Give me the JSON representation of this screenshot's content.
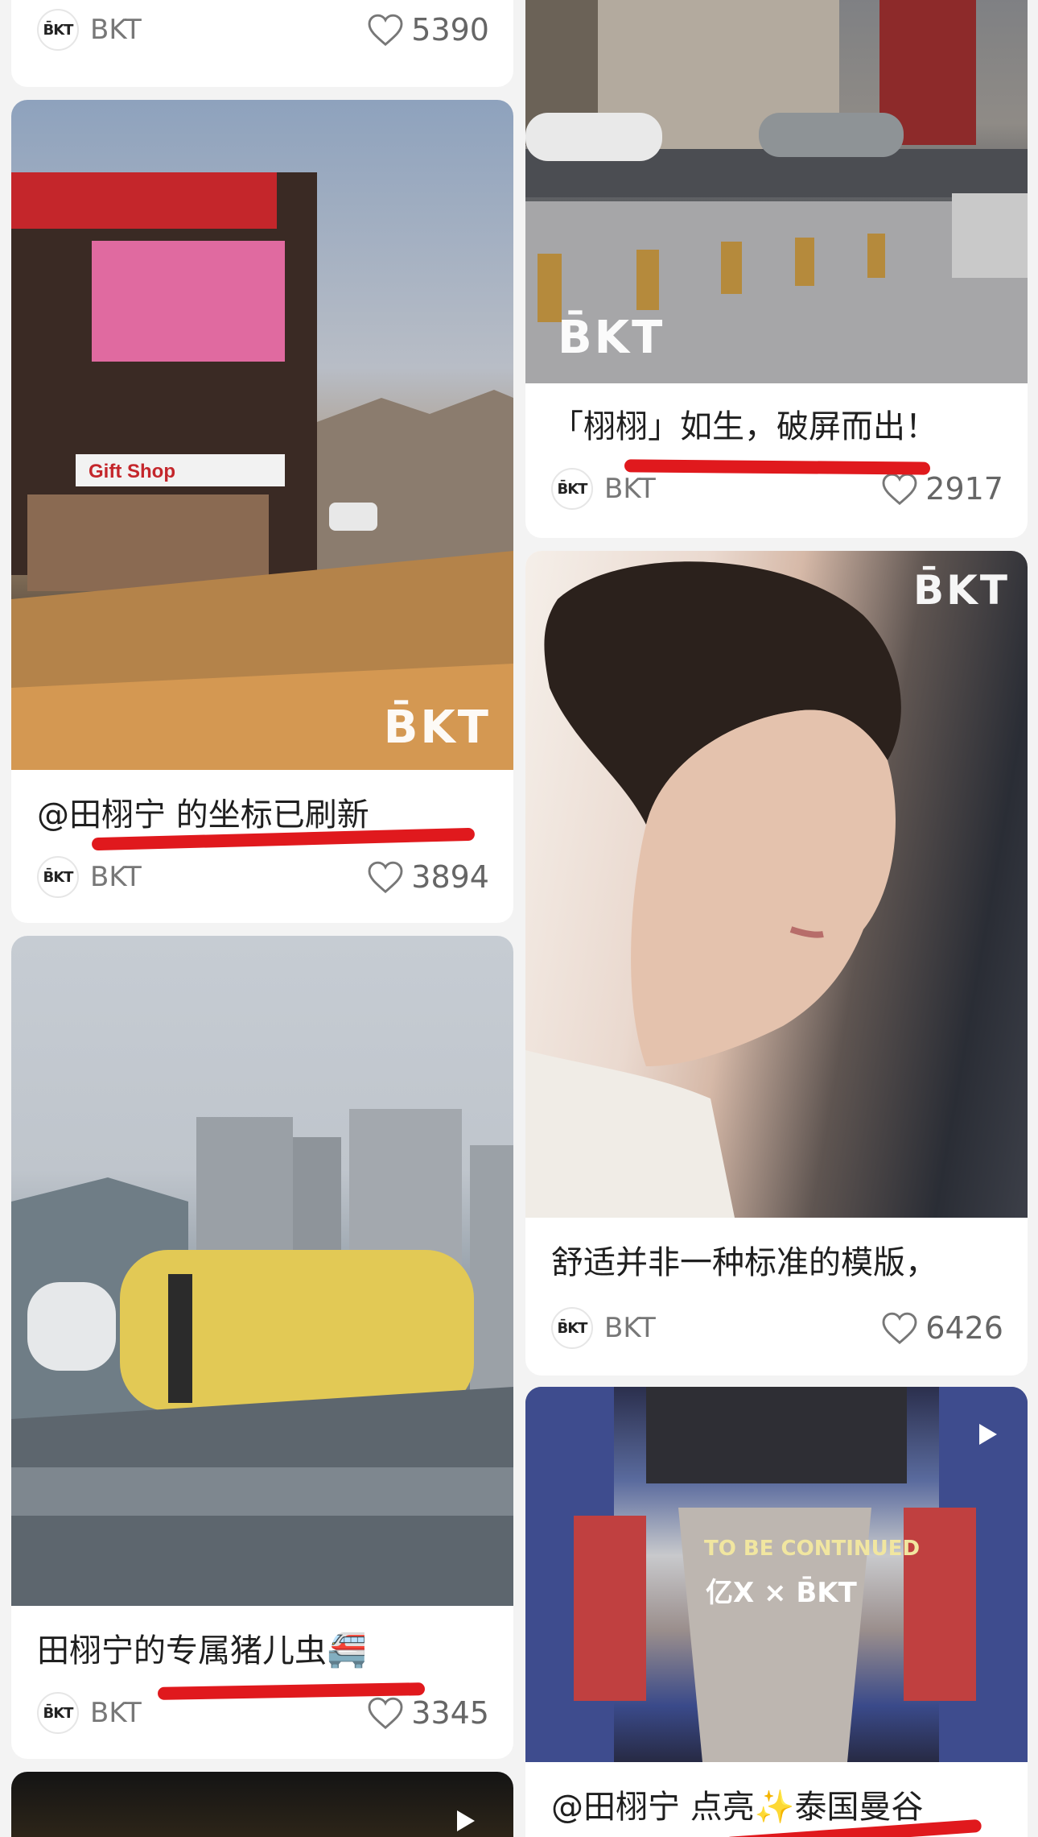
{
  "author_name": "BKT",
  "avatar_text": "B̄KT",
  "watermark": "B̄KT",
  "cards": [
    {
      "likes": "5390"
    },
    {
      "title": "@田栩宁 的坐标已刷新",
      "likes": "3894",
      "shop_sign": "Gift Shop"
    },
    {
      "title": "田栩宁的专属猪儿虫🚝",
      "likes": "3345"
    },
    {
      "title": "「栩栩」如生，破屏而出！",
      "likes": "2917"
    },
    {
      "title": "舒适并非一种标准的模版，",
      "likes": "6426"
    },
    {
      "title": "@田栩宁 点亮✨泰国曼谷",
      "overlay": "TO BE CONTINUED",
      "overlay_logos": "亿X × B̄KT"
    }
  ],
  "icons": {
    "like": "heart-outline-icon",
    "play": "play-icon"
  },
  "colors": {
    "underline": "#e0191d",
    "background": "#f3f3f3",
    "card": "#ffffff"
  }
}
